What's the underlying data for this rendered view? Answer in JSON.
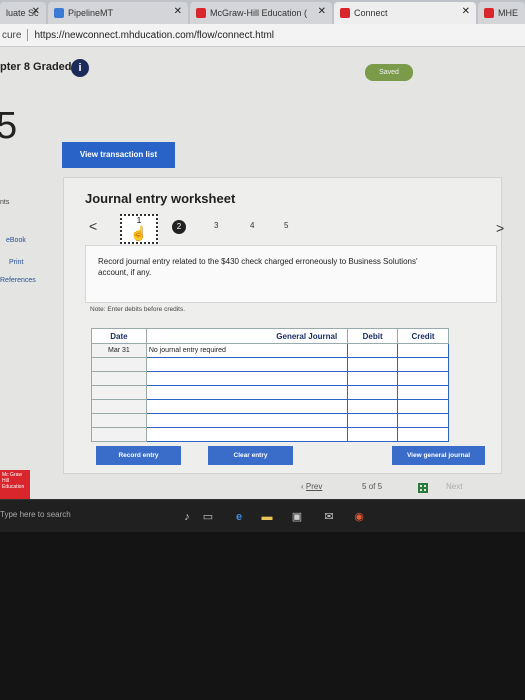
{
  "tabs": [
    {
      "label": "Ɩuate Sc",
      "close": "✕"
    },
    {
      "label": "PipelineMT",
      "close": "✕"
    },
    {
      "label": "McGraw-Hill Education (",
      "close": "✕"
    },
    {
      "label": "Connect",
      "close": "✕"
    },
    {
      "label": "MHE",
      "close": ""
    }
  ],
  "address": {
    "secure": "cure",
    "url": "https://newconnect.mhducation.com/flow/connect.html"
  },
  "header": {
    "chapter_title": "pter 8 Graded",
    "info": "i",
    "saved": "Saved"
  },
  "question_number": "5",
  "view_transaction_label": "View transaction list",
  "sidebar": {
    "points": "nts",
    "ebook": "eBook",
    "print": "Print",
    "references": "References"
  },
  "worksheet": {
    "title": "Journal entry worksheet",
    "prev_arrow": "<",
    "next_arrow": ">",
    "steps": [
      "1",
      "2",
      "3",
      "4",
      "5"
    ],
    "instruction": "Record journal entry related to the $430 check charged erroneously to Business Solutions' account, if any.",
    "note": "Note: Enter debits before credits.",
    "table": {
      "headers": {
        "date": "Date",
        "general_journal": "General Journal",
        "debit": "Debit",
        "credit": "Credit"
      },
      "rows": [
        {
          "date": "Mar 31",
          "account": "No journal entry required",
          "debit": "",
          "credit": ""
        },
        {
          "date": "",
          "account": "",
          "debit": "",
          "credit": ""
        },
        {
          "date": "",
          "account": "",
          "debit": "",
          "credit": ""
        },
        {
          "date": "",
          "account": "",
          "debit": "",
          "credit": ""
        },
        {
          "date": "",
          "account": "",
          "debit": "",
          "credit": ""
        },
        {
          "date": "",
          "account": "",
          "debit": "",
          "credit": ""
        },
        {
          "date": "",
          "account": "",
          "debit": "",
          "credit": ""
        }
      ]
    },
    "buttons": {
      "record": "Record entry",
      "clear": "Clear entry",
      "view_general": "View general journal"
    }
  },
  "pager": {
    "prev": "Prev",
    "page": "5",
    "of": "of",
    "total": "5",
    "next": "Next"
  },
  "logo": {
    "text": "Mc Graw Hill Education"
  },
  "taskbar": {
    "search_placeholder": "Type here to search"
  },
  "colors": {
    "accent": "#2a63c8",
    "saved": "#7b9b4b",
    "logo": "#d9262d"
  }
}
